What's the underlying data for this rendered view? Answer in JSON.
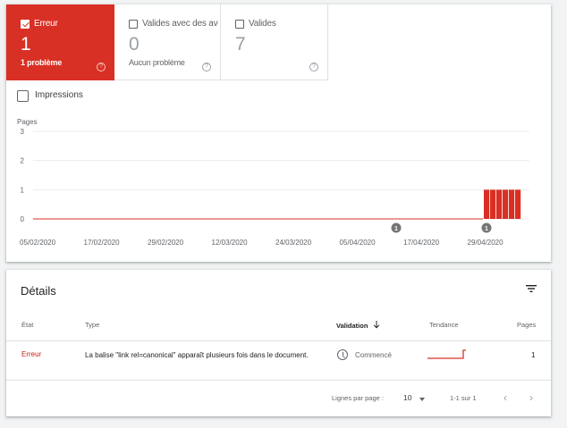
{
  "tiles": {
    "error": {
      "label": "Erreur",
      "count": "1",
      "subtitle": "1 problème",
      "checked": true
    },
    "valid_warning": {
      "label": "Valides avec des avertissements",
      "count": "0",
      "subtitle": "Aucun problème",
      "checked": false
    },
    "valid": {
      "label": "Valides",
      "count": "7",
      "subtitle": "",
      "checked": false
    },
    "help_glyph": "?"
  },
  "impressions": {
    "label": "Impressions",
    "checked": false
  },
  "chart_data": {
    "type": "bar",
    "ylabel": "Pages",
    "y_ticks": [
      "3",
      "2",
      "1",
      "0"
    ],
    "ylim": [
      0,
      3
    ],
    "x_tick_labels": [
      "05/02/2020",
      "17/02/2020",
      "29/02/2020",
      "12/03/2020",
      "24/03/2020",
      "05/04/2020",
      "17/04/2020",
      "29/04/2020"
    ],
    "series": [
      {
        "values": [
          1,
          1,
          1,
          1,
          1,
          1
        ],
        "color": "#d93025"
      }
    ],
    "zero_line_color": "#d93025",
    "annotations": [
      {
        "label": "1",
        "near_date": "14/04/2020"
      },
      {
        "label": "1",
        "near_date": "29/04/2020"
      }
    ],
    "grid": true
  },
  "details": {
    "title": "Détails",
    "columns": {
      "state": "État",
      "type": "Type",
      "validation": "Validation",
      "trend": "Tendance",
      "pages": "Pages"
    },
    "rows": [
      {
        "state": "Erreur",
        "type": "La balise \"link rel=canonical\" apparaît plusieurs fois dans le document.",
        "validation": "Commencé",
        "pages": "1"
      }
    ],
    "footer": {
      "rows_per_page_label": "Lignes par page :",
      "rows_per_page_value": "10",
      "range": "1-1 sur 1",
      "prev": "‹",
      "next": "›"
    }
  },
  "colors": {
    "error": "#d93025",
    "text_secondary": "#5f6368"
  }
}
